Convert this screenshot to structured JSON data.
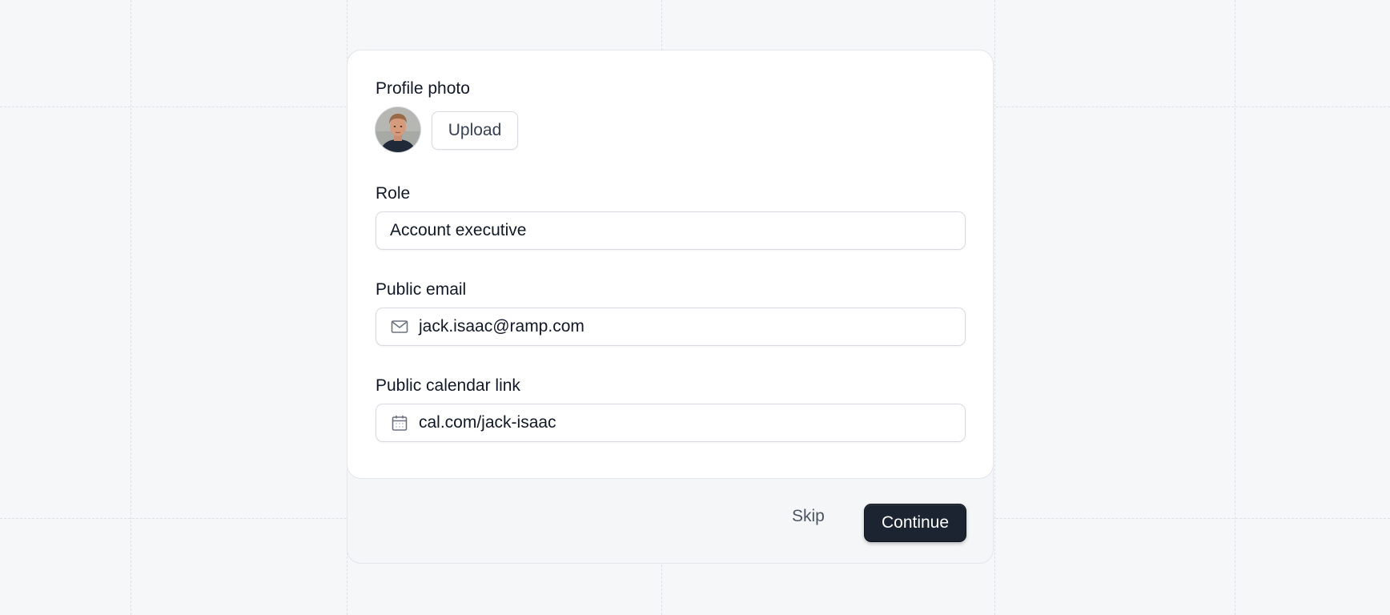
{
  "form": {
    "profile_photo": {
      "label": "Profile photo",
      "upload_label": "Upload"
    },
    "role": {
      "label": "Role",
      "value": "Account executive"
    },
    "public_email": {
      "label": "Public email",
      "value": "jack.isaac@ramp.com",
      "icon": "mail-icon"
    },
    "public_calendar_link": {
      "label": "Public calendar link",
      "value": "cal.com/jack-isaac",
      "icon": "calendar-icon"
    }
  },
  "footer": {
    "skip_label": "Skip",
    "continue_label": "Continue"
  },
  "colors": {
    "background": "#f6f7f9",
    "card": "#ffffff",
    "primary_button": "#1b2430",
    "border": "#d7dbe0"
  }
}
